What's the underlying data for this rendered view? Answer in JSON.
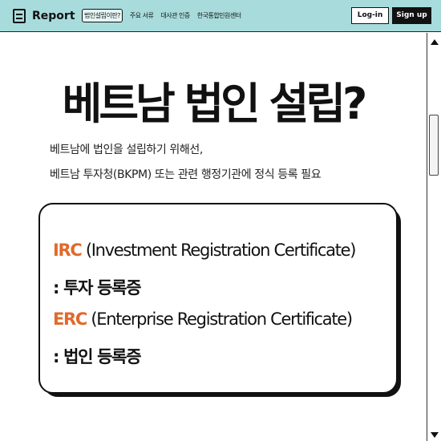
{
  "header": {
    "logo_text": "Report",
    "nav": [
      "법인설립이란?",
      "주요 서류",
      "대사관 인증",
      "한국통합민원센터"
    ],
    "login_label": "Log-in",
    "signup_label": "Sign up"
  },
  "main": {
    "title": "베트남 법인 설립?",
    "desc_line1": "베트남에 법인을 설립하기 위해선,",
    "desc_line2": "베트남 투자청(BKPM) 또는 관련 행정기관에 정식 등록 필요",
    "card": {
      "irc_code": "IRC",
      "irc_full": " (Investment Registration Certificate)",
      "irc_kor": ": 투자 등록증",
      "erc_code": "ERC",
      "erc_full": " (Enterprise Registration Certificate)",
      "erc_kor": ": 법인 등록증"
    }
  },
  "colors": {
    "header_bg": "#a8dcdc",
    "accent_orange": "#e06a2c"
  }
}
